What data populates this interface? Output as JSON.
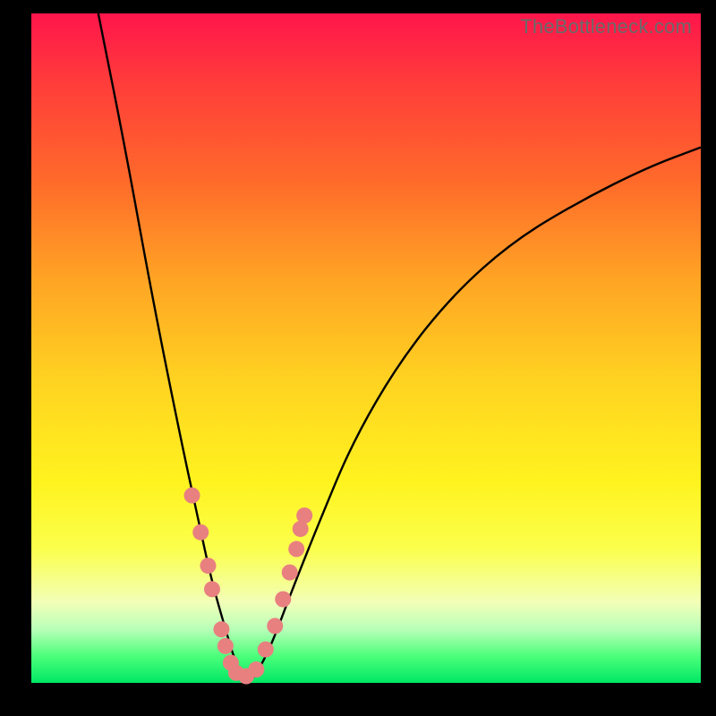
{
  "watermark": "TheBottleneck.com",
  "colors": {
    "curve": "#000000",
    "markers": "#e88080",
    "background_frame": "#000000"
  },
  "chart_data": {
    "type": "line",
    "title": "",
    "xlabel": "",
    "ylabel": "",
    "xlim": [
      0,
      100
    ],
    "ylim": [
      0,
      100
    ],
    "grid": false,
    "legend": false,
    "series": [
      {
        "name": "bottleneck-curve",
        "x": [
          10,
          14,
          18,
          22,
          25,
          27,
          29,
          30.5,
          32,
          33,
          34,
          36,
          39,
          43,
          48,
          55,
          63,
          72,
          82,
          92,
          100
        ],
        "y": [
          100,
          80,
          58,
          38,
          24,
          15,
          8,
          3,
          0.5,
          0.5,
          2,
          6,
          14,
          24,
          36,
          48,
          58,
          66,
          72,
          77,
          80
        ]
      }
    ],
    "markers": {
      "name": "highlighted-points",
      "x": [
        24.0,
        25.3,
        26.4,
        27.0,
        28.4,
        29.0,
        29.8,
        30.6,
        32.1,
        33.6,
        35.0,
        36.4,
        37.6,
        38.6,
        39.6,
        40.2,
        40.8
      ],
      "y": [
        28.0,
        22.5,
        17.5,
        14.0,
        8.0,
        5.5,
        3.0,
        1.5,
        1.0,
        2.0,
        5.0,
        8.5,
        12.5,
        16.5,
        20.0,
        23.0,
        25.0
      ],
      "radius": 9
    }
  }
}
